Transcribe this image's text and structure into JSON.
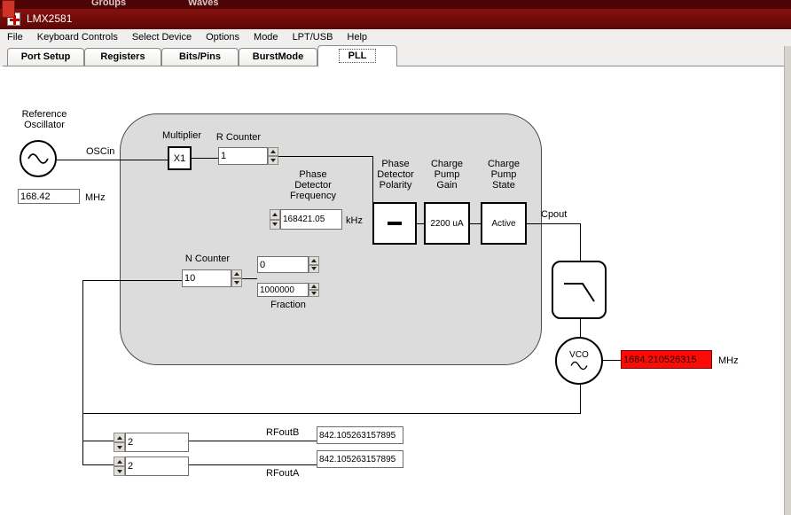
{
  "chrome": {
    "background_fragments": [
      "Groups",
      "Waves"
    ],
    "title": "LMX2581"
  },
  "menu": {
    "items": [
      "File",
      "Keyboard Controls",
      "Select Device",
      "Options",
      "Mode",
      "LPT/USB",
      "Help"
    ]
  },
  "tabs": {
    "items": [
      "Port Setup",
      "Registers",
      "Bits/Pins",
      "BurstMode",
      "PLL"
    ],
    "selected": "PLL"
  },
  "colors": {
    "titlebar": "#6e0a0a",
    "vco_field_bg": "#fb0d07"
  },
  "diagram": {
    "reference": {
      "title": "Reference\nOscillator",
      "oscin": "OSCin",
      "freq": "168.42",
      "unit": "MHz"
    },
    "multiplier": {
      "label": "Multiplier",
      "value": "X1"
    },
    "r_counter": {
      "label": "R Counter",
      "value": "1"
    },
    "pdf": {
      "label": "Phase\nDetector\nFrequency",
      "value": "168421.05",
      "unit": "kHz"
    },
    "pd_polarity": {
      "label": "Phase\nDetector\nPolarity"
    },
    "cp_gain": {
      "label": "Charge\nPump\nGain",
      "value": "2200 uA"
    },
    "cp_state": {
      "label": "Charge\nPump\nState",
      "value": "Active"
    },
    "cpout": "Cpout",
    "n_counter": {
      "label": "N Counter",
      "value": "10"
    },
    "fraction": {
      "num": "0",
      "den": "1000000",
      "label": "Fraction"
    },
    "vco": {
      "label": "VCO",
      "freq": "1684.210526315",
      "unit": "MHz"
    },
    "outputs": {
      "rfoutb": {
        "div": "2",
        "label": "RFoutB",
        "value": "842.105263157895"
      },
      "rfouta": {
        "div": "2",
        "label": "RFoutA",
        "value": "842.105263157895"
      }
    }
  }
}
